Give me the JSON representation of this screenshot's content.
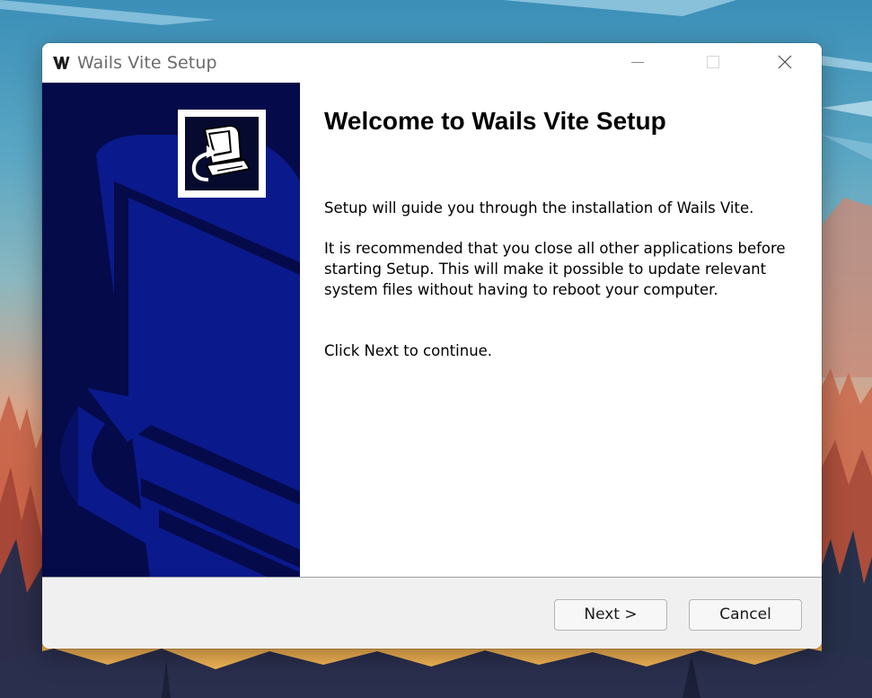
{
  "window": {
    "title": "Wails Vite Setup",
    "app_icon": "wails-w-icon",
    "caption_buttons": [
      "minimize-icon",
      "maximize-icon",
      "close-icon"
    ]
  },
  "banner": {
    "logo": "installer-computer-icon",
    "color": "#050a4a"
  },
  "content": {
    "heading": "Welcome to Wails Vite Setup",
    "paragraph_1": "Setup will guide you through the installation of Wails Vite.",
    "paragraph_2": "It is recommended that you close all other applications before starting Setup. This will make it possible to update relevant system files without having to reboot your computer.",
    "paragraph_3": "Click Next to continue."
  },
  "footer": {
    "next_label": "Next >",
    "cancel_label": "Cancel"
  },
  "colors": {
    "banner_blue": "#050a4a",
    "banner_accent": "#0a1a8c",
    "footer_bg": "#f0f0f0"
  }
}
